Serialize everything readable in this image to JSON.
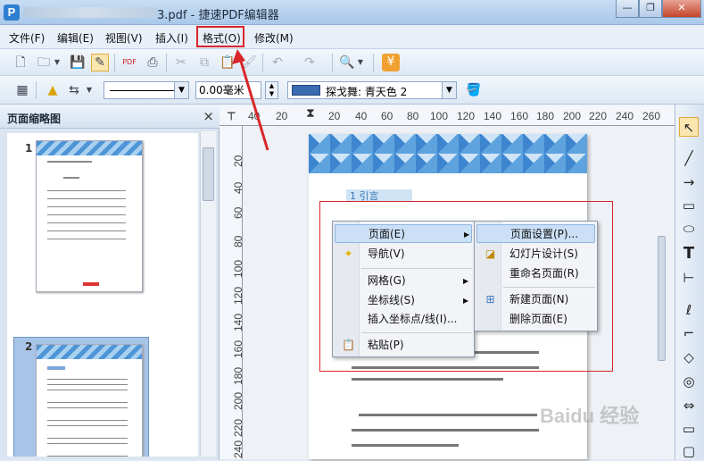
{
  "window": {
    "title": "3.pdf - 捷速PDF编辑器",
    "logo": "P",
    "controls": [
      "—",
      "❐",
      "✕"
    ]
  },
  "menubar": {
    "items": [
      "文件(F)",
      "编辑(E)",
      "视图(V)",
      "插入(I)",
      "格式(O)",
      "修改(M)"
    ]
  },
  "toolbar2": {
    "line_width": "0.00毫米",
    "color_name": "探戈舞: 青天色 2"
  },
  "thumbnail_panel": {
    "title": "页面缩略图",
    "close": "×",
    "pages": [
      "1",
      "2"
    ]
  },
  "ruler": {
    "h_ticks": [
      "40",
      "20",
      "20",
      "40",
      "60",
      "80",
      "100",
      "120",
      "140",
      "160",
      "180",
      "200",
      "220",
      "240",
      "260"
    ],
    "v_ticks": [
      "20",
      "40",
      "60",
      "80",
      "100",
      "120",
      "140",
      "160",
      "180",
      "200",
      "220",
      "240"
    ]
  },
  "document": {
    "heading": "1 引言"
  },
  "context_menu": {
    "items": [
      {
        "label": "页面(E)",
        "submenu": true,
        "icon": ""
      },
      {
        "label": "导航(V)",
        "submenu": false,
        "icon": "star-icon"
      },
      {
        "label": "网格(G)",
        "submenu": true,
        "icon": ""
      },
      {
        "label": "坐标线(S)",
        "submenu": true,
        "icon": ""
      },
      {
        "label": "插入坐标点/线(I)...",
        "submenu": false,
        "icon": ""
      },
      {
        "label": "粘贴(P)",
        "submenu": false,
        "icon": "paste-icon"
      }
    ]
  },
  "submenu": {
    "items": [
      {
        "label": "页面设置(P)...",
        "icon": ""
      },
      {
        "label": "幻灯片设计(S)",
        "icon": "slide-design-icon"
      },
      {
        "label": "重命名页面(R)",
        "icon": ""
      },
      {
        "label": "新建页面(N)",
        "icon": "new-page-icon"
      },
      {
        "label": "删除页面(E)",
        "icon": ""
      }
    ]
  },
  "right_tools": [
    "↖",
    "╱",
    "→",
    "▭",
    "⬭",
    "T",
    "⊢",
    "ℓ",
    "⌐",
    "◇",
    "◎",
    "⇔",
    "▭",
    "▢"
  ],
  "watermark": "Baidu 经验",
  "colors": {
    "accent_red": "#d8262b",
    "swatch": "#3a6cb0",
    "highlight": "#cbe0f6"
  }
}
